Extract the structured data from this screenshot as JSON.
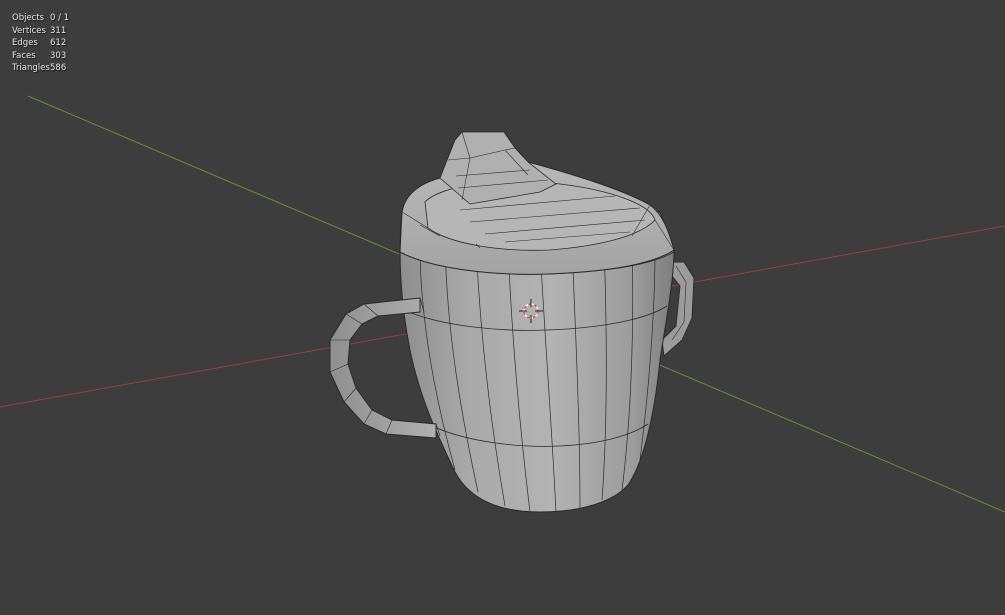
{
  "viewport": {
    "background": "#3d3d3d",
    "axes": {
      "x_axis_color": "#9a3b4a",
      "y_axis_color": "#6e8b2e"
    },
    "object": {
      "name": "sippy-cup",
      "surface_color": "#a6a6a6",
      "wire_color": "#2a2a2a"
    },
    "cursor_icon": "3d-cursor-icon"
  },
  "stats": [
    {
      "label": "Objects",
      "value": "0 / 1"
    },
    {
      "label": "Vertices",
      "value": "311"
    },
    {
      "label": "Edges",
      "value": "612"
    },
    {
      "label": "Faces",
      "value": "303"
    },
    {
      "label": "Triangles",
      "value": "586"
    }
  ]
}
